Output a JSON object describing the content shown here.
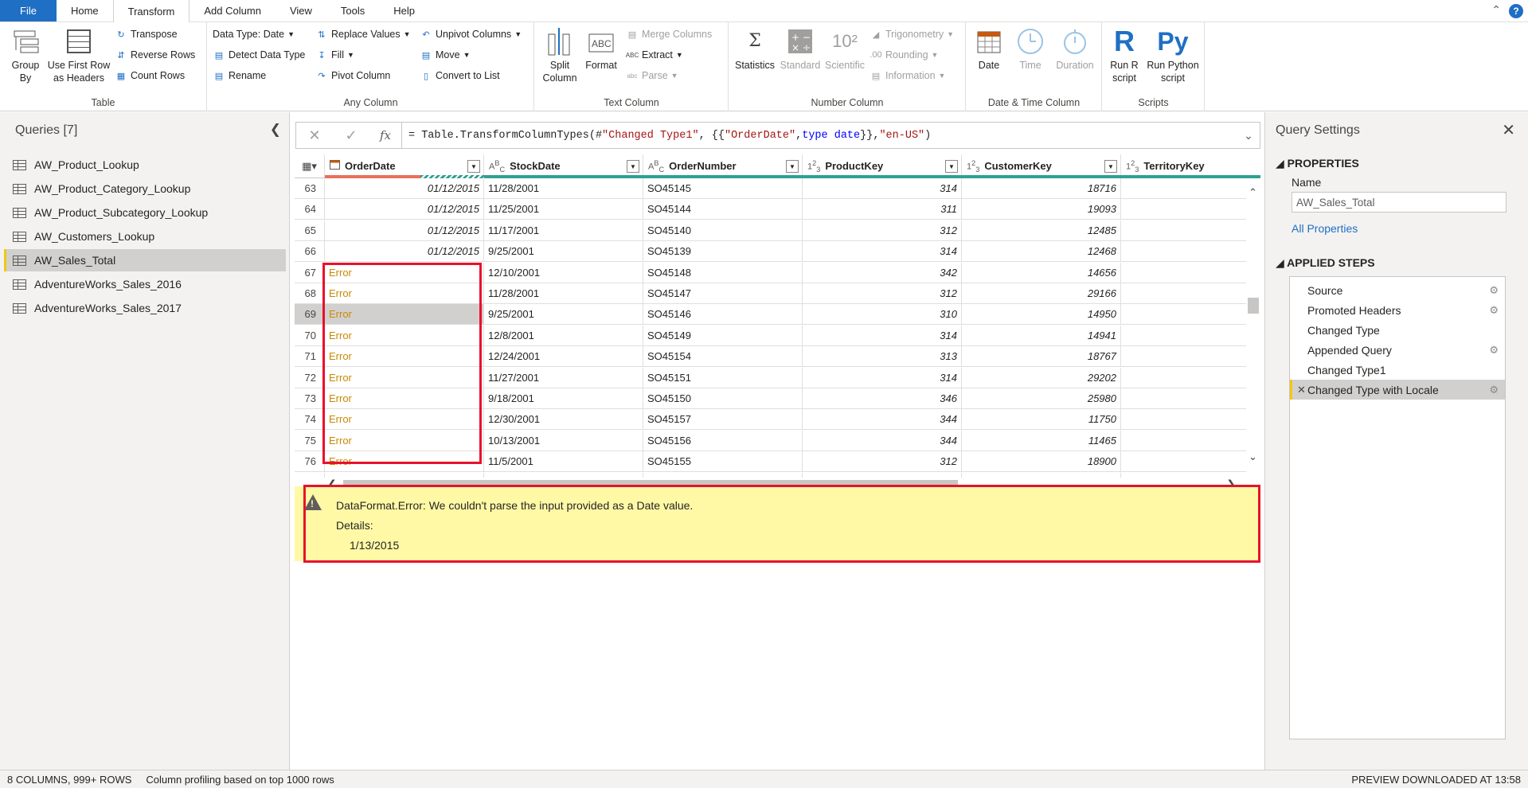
{
  "menu": {
    "tabs": [
      "File",
      "Home",
      "Transform",
      "Add Column",
      "View",
      "Tools",
      "Help"
    ],
    "active": "Transform"
  },
  "ribbon": {
    "table": {
      "label": "Table",
      "group_by": "Group\nBy",
      "use_first_row": "Use First Row\nas Headers",
      "transpose": "Transpose",
      "reverse_rows": "Reverse Rows",
      "count_rows": "Count Rows"
    },
    "any_column": {
      "label": "Any Column",
      "data_type": "Data Type: Date",
      "detect_data_type": "Detect Data Type",
      "rename": "Rename",
      "replace_values": "Replace Values",
      "fill": "Fill",
      "pivot_column": "Pivot Column",
      "unpivot_columns": "Unpivot Columns",
      "move": "Move",
      "convert_to_list": "Convert to List"
    },
    "text_column": {
      "label": "Text Column",
      "split_column": "Split\nColumn",
      "format": "Format",
      "merge_columns": "Merge Columns",
      "extract": "Extract",
      "parse": "Parse"
    },
    "number_column": {
      "label": "Number Column",
      "statistics": "Statistics",
      "standard": "Standard",
      "scientific": "Scientific",
      "trigonometry": "Trigonometry",
      "rounding": "Rounding",
      "information": "Information"
    },
    "datetime_column": {
      "label": "Date & Time Column",
      "date": "Date",
      "time": "Time",
      "duration": "Duration"
    },
    "scripts": {
      "label": "Scripts",
      "run_r": "Run R\nscript",
      "run_python": "Run Python\nscript"
    }
  },
  "queries": {
    "title": "Queries [7]",
    "items": [
      "AW_Product_Lookup",
      "AW_Product_Category_Lookup",
      "AW_Product_Subcategory_Lookup",
      "AW_Customers_Lookup",
      "AW_Sales_Total",
      "AdventureWorks_Sales_2016",
      "AdventureWorks_Sales_2017"
    ],
    "selected": 4
  },
  "formula": {
    "prefix": "= Table.TransformColumnTypes(#",
    "s1": "\"Changed Type1\"",
    "mid1": ", {{",
    "s2": "\"OrderDate\"",
    "mid2": ", ",
    "kw1": "type",
    "sp": " ",
    "kw2": "date",
    "mid3": "}}, ",
    "s3": "\"en-US\"",
    "suffix": ")"
  },
  "columns": [
    {
      "name": "OrderDate",
      "type": "date"
    },
    {
      "name": "StockDate",
      "type": "ABC"
    },
    {
      "name": "OrderNumber",
      "type": "ABC"
    },
    {
      "name": "ProductKey",
      "type": "123"
    },
    {
      "name": "CustomerKey",
      "type": "123"
    },
    {
      "name": "TerritoryKey",
      "type": "123"
    }
  ],
  "rows": [
    {
      "n": "63",
      "order_date": "01/12/2015",
      "stock_date": "11/28/2001",
      "order_number": "SO45145",
      "product_key": "314",
      "customer_key": "18716"
    },
    {
      "n": "64",
      "order_date": "01/12/2015",
      "stock_date": "11/25/2001",
      "order_number": "SO45144",
      "product_key": "311",
      "customer_key": "19093"
    },
    {
      "n": "65",
      "order_date": "01/12/2015",
      "stock_date": "11/17/2001",
      "order_number": "SO45140",
      "product_key": "312",
      "customer_key": "12485"
    },
    {
      "n": "66",
      "order_date": "01/12/2015",
      "stock_date": "9/25/2001",
      "order_number": "SO45139",
      "product_key": "314",
      "customer_key": "12468"
    },
    {
      "n": "67",
      "order_date": "Error",
      "stock_date": "12/10/2001",
      "order_number": "SO45148",
      "product_key": "342",
      "customer_key": "14656"
    },
    {
      "n": "68",
      "order_date": "Error",
      "stock_date": "11/28/2001",
      "order_number": "SO45147",
      "product_key": "312",
      "customer_key": "29166"
    },
    {
      "n": "69",
      "order_date": "Error",
      "stock_date": "9/25/2001",
      "order_number": "SO45146",
      "product_key": "310",
      "customer_key": "14950"
    },
    {
      "n": "70",
      "order_date": "Error",
      "stock_date": "12/8/2001",
      "order_number": "SO45149",
      "product_key": "314",
      "customer_key": "14941"
    },
    {
      "n": "71",
      "order_date": "Error",
      "stock_date": "12/24/2001",
      "order_number": "SO45154",
      "product_key": "313",
      "customer_key": "18767"
    },
    {
      "n": "72",
      "order_date": "Error",
      "stock_date": "11/27/2001",
      "order_number": "SO45151",
      "product_key": "314",
      "customer_key": "29202"
    },
    {
      "n": "73",
      "order_date": "Error",
      "stock_date": "9/18/2001",
      "order_number": "SO45150",
      "product_key": "346",
      "customer_key": "25980"
    },
    {
      "n": "74",
      "order_date": "Error",
      "stock_date": "12/30/2001",
      "order_number": "SO45157",
      "product_key": "344",
      "customer_key": "11750"
    },
    {
      "n": "75",
      "order_date": "Error",
      "stock_date": "10/13/2001",
      "order_number": "SO45156",
      "product_key": "344",
      "customer_key": "11465"
    },
    {
      "n": "76",
      "order_date": "Error",
      "stock_date": "11/5/2001",
      "order_number": "SO45155",
      "product_key": "312",
      "customer_key": "18900"
    },
    {
      "n": "77",
      "order_date": "",
      "stock_date": "",
      "order_number": "",
      "product_key": "",
      "customer_key": ""
    }
  ],
  "selected_row": "69",
  "error": {
    "message": "DataFormat.Error: We couldn't parse the input provided as a Date value.",
    "details_label": "Details:",
    "details_value": "1/13/2015"
  },
  "settings": {
    "title": "Query Settings",
    "properties": "PROPERTIES",
    "name_label": "Name",
    "name_value": "AW_Sales_Total",
    "all_properties": "All Properties",
    "applied_steps": "APPLIED STEPS",
    "steps": [
      {
        "label": "Source",
        "gear": true
      },
      {
        "label": "Promoted Headers",
        "gear": true
      },
      {
        "label": "Changed Type",
        "gear": false
      },
      {
        "label": "Appended Query",
        "gear": true
      },
      {
        "label": "Changed Type1",
        "gear": false
      },
      {
        "label": "Changed Type with Locale",
        "gear": true
      }
    ],
    "selected_step": 5
  },
  "status": {
    "columns_rows": "8 COLUMNS, 999+ ROWS",
    "profiling": "Column profiling based on top 1000 rows",
    "preview": "PREVIEW DOWNLOADED AT 13:58"
  },
  "colors": {
    "accent": "#1f6fc4",
    "error_box": "#e8112d",
    "error_panel": "#fff9a6",
    "selection_marker": "#f2c811"
  }
}
